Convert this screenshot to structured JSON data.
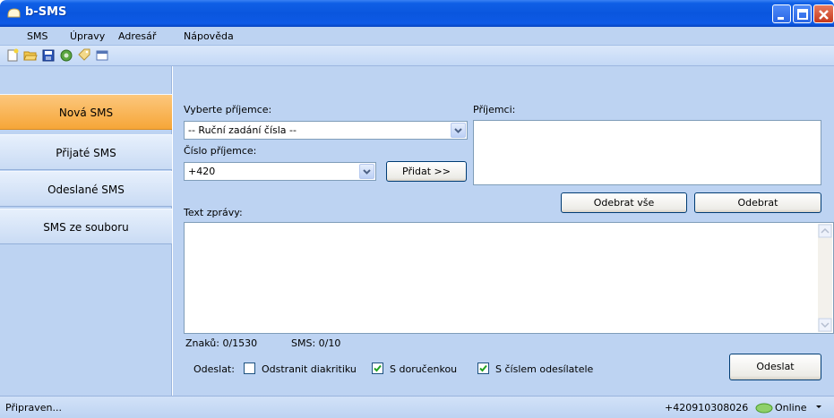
{
  "window": {
    "title": "b-SMS"
  },
  "menu": [
    "SMS",
    "Úpravy",
    "Adresář",
    "Nápověda"
  ],
  "toolbar": {
    "icons": [
      "new-icon",
      "open-icon",
      "save-icon",
      "settings-icon",
      "tag-icon",
      "window-icon"
    ]
  },
  "sidebar": {
    "items": [
      "Nová SMS",
      "Přijaté SMS",
      "Odeslané SMS",
      "SMS ze souboru"
    ],
    "active_index": 0
  },
  "form": {
    "select_recipient_label": "Vyberte příjemce:",
    "select_recipient_value": "-- Ruční zadání čísla --",
    "number_label": "Číslo příjemce:",
    "number_value": "+420",
    "add_button": "Přidat >>",
    "recipients_label": "Příjemci:",
    "remove_all_button": "Odebrat vše",
    "remove_button": "Odebrat",
    "message_label": "Text zprávy:",
    "chars_counter": "Znaků: 0/1530",
    "sms_counter": "SMS: 0/10",
    "send_label": "Odeslat:",
    "opt_remove_diacritics": {
      "label": "Odstranit diakritiku",
      "checked": false
    },
    "opt_delivery_report": {
      "label": "S doručenkou",
      "checked": true
    },
    "opt_sender_number": {
      "label": "S číslem odesílatele",
      "checked": true
    },
    "send_button": "Odeslat"
  },
  "status": {
    "text": "Připraven...",
    "phone": "+420910308026",
    "online": "Online"
  },
  "colors": {
    "accent": "#0a56de",
    "panel": "#bdd3f2",
    "active_nav": "#f6a638"
  }
}
